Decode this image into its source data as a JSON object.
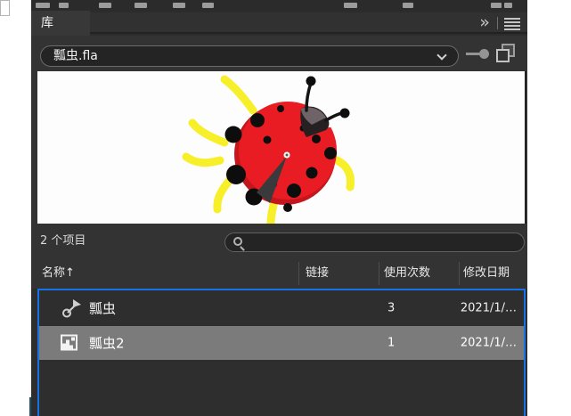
{
  "panel": {
    "tab_title": "库",
    "header_icons": [
      "collapse-to-icons",
      "panel-menu"
    ],
    "document_selector": {
      "value": "瓢虫.fla"
    },
    "toolbar_icons": [
      "pin-library",
      "new-library-panel"
    ],
    "preview": {
      "content": "ladybug-symbol-drawing"
    },
    "items_count": "2 个项目",
    "search": {
      "value": "",
      "placeholder": ""
    },
    "columns": {
      "name": "名称",
      "sort_arrow": "↑",
      "linkage": "链接",
      "use_count": "使用次数",
      "modified": "修改日期"
    },
    "rows": [
      {
        "icon": "graphic-symbol",
        "name": "瓢虫",
        "linkage": "",
        "use_count": "3",
        "modified": "2021/1/…",
        "selected": false
      },
      {
        "icon": "bitmap",
        "name": "瓢虫2",
        "linkage": "",
        "use_count": "1",
        "modified": "2021/1/…",
        "selected": true
      }
    ]
  },
  "colors": {
    "panel_bg": "#333333",
    "list_bg": "#2e2e2e",
    "focus_ring_blue": "#1473e6",
    "selected_row_gray": "#7b7b7b",
    "ladybug_red": "#e91c23",
    "ladybug_leg_yellow": "#f8ef2b"
  }
}
